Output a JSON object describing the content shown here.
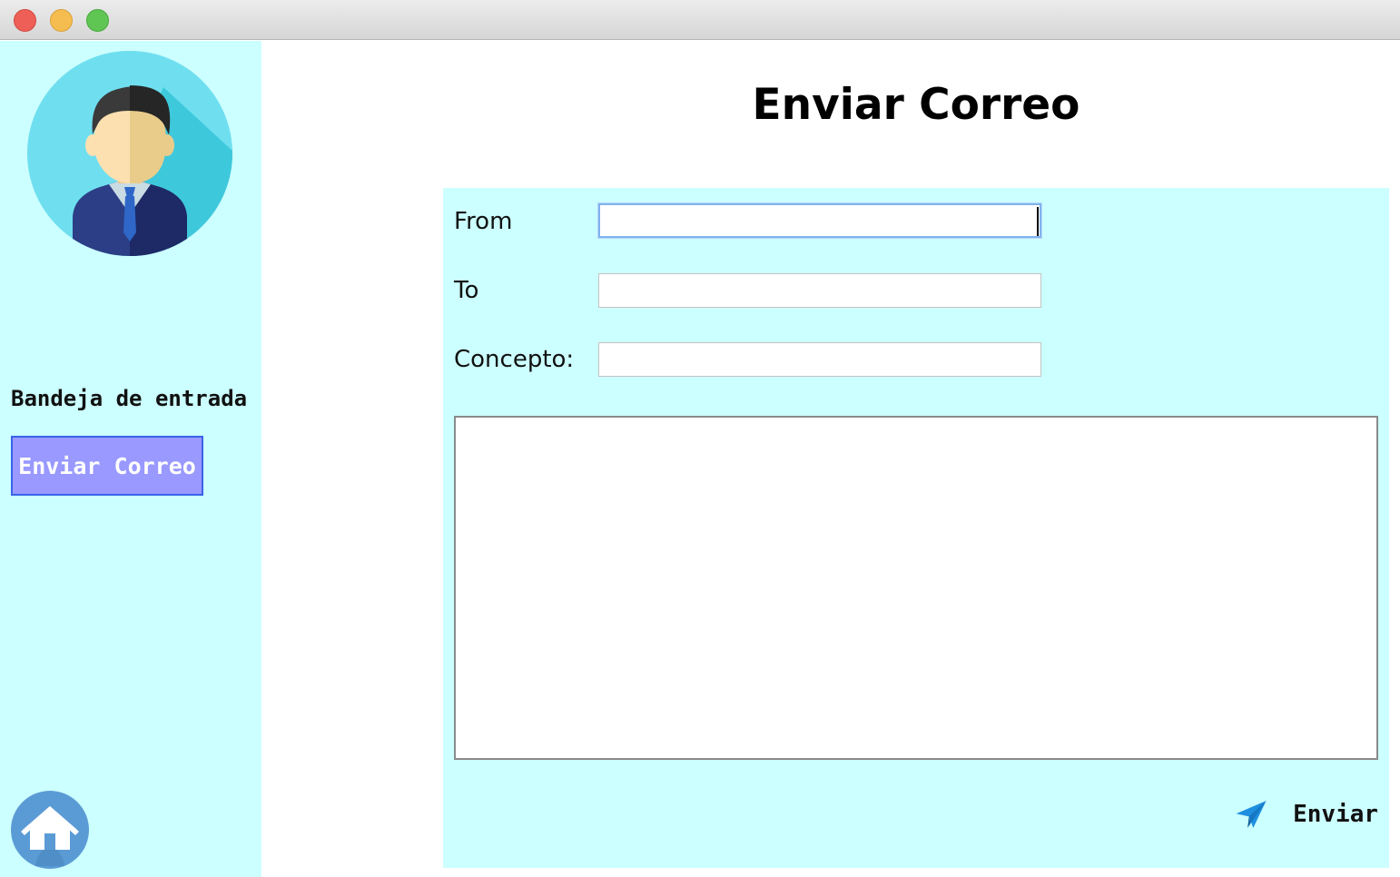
{
  "window": {
    "controls": [
      "close",
      "minimize",
      "maximize"
    ]
  },
  "sidebar": {
    "avatar_icon": "user-avatar-icon",
    "inbox_label": "Bandeja de entrada",
    "send_mail_button": "Enviar Correo",
    "home_icon": "home-icon"
  },
  "main": {
    "title": "Enviar Correo",
    "form": {
      "from_label": "From",
      "from_value": "",
      "to_label": "To",
      "to_value": "",
      "subject_label": "Concepto:",
      "subject_value": "",
      "body_value": ""
    },
    "send_button": "Enviar",
    "send_icon": "paper-plane-icon"
  },
  "colors": {
    "sidebar_bg": "#ccffff",
    "panel_bg": "#ccffff",
    "nav_button_bg": "#9999ff",
    "nav_button_border": "#3a63e8",
    "accent_blue": "#1e8fe0"
  }
}
